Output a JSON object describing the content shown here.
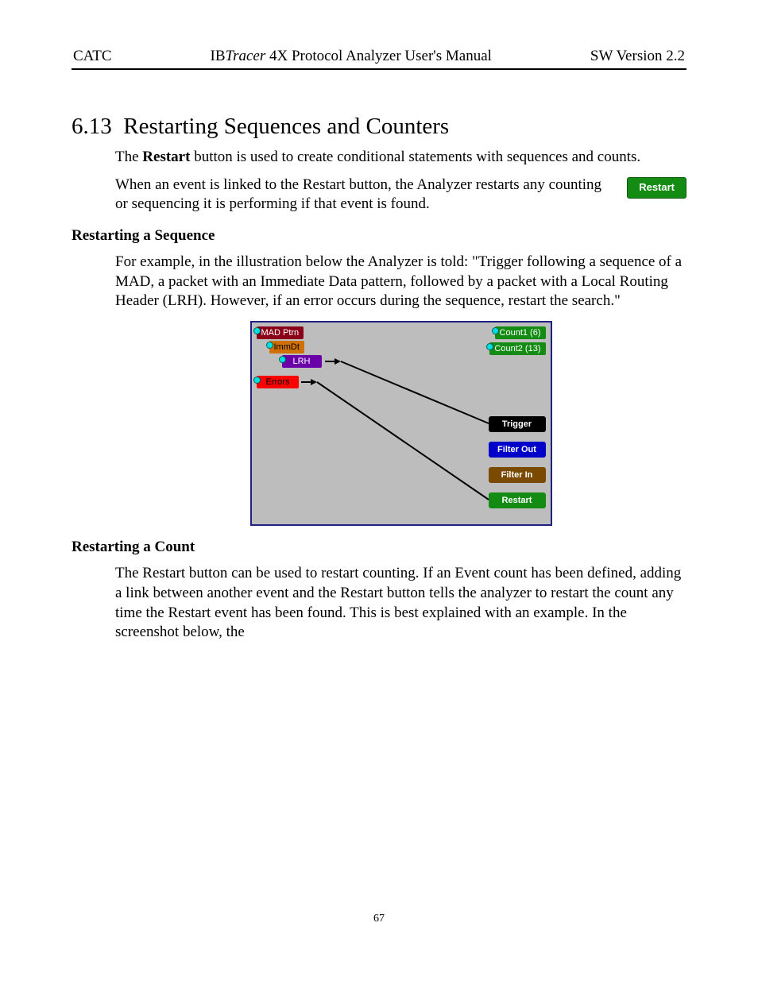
{
  "header": {
    "left": "CATC",
    "center_prefix": "IB",
    "center_italic": "Tracer",
    "center_suffix": " 4X Protocol Analyzer User's Manual",
    "right": "SW Version 2.2"
  },
  "section": {
    "number": "6.13",
    "title": "Restarting Sequences and Counters",
    "para1_a": "The ",
    "para1_bold": "Restart",
    "para1_b": " button is used to create conditional statements with sequences and counts.",
    "para2": "When an event is linked to the Restart button, the Analyzer restarts any counting or sequencing it is performing if that event is found.",
    "restart_btn": "Restart"
  },
  "sub1": {
    "heading": "Restarting a Sequence",
    "para": "For example, in the illustration below the Analyzer is told: \"Trigger following a sequence of a MAD, a packet with an Immediate Data pattern, followed by a packet with a Local Routing Header (LRH). However, if an error occurs during the sequence, restart the search.\""
  },
  "diagram": {
    "events": {
      "mad": "MAD Ptrn",
      "immdt": "ImmDt",
      "lrh": "LRH",
      "errors": "Errors"
    },
    "counts": {
      "c1": "Count1 (6)",
      "c2": "Count2 (13)"
    },
    "actions": {
      "trigger": "Trigger",
      "filter_out": "Filter Out",
      "filter_in": "Filter In",
      "restart": "Restart"
    }
  },
  "sub2": {
    "heading": "Restarting a Count",
    "para": "The Restart button can be used to restart counting. If an Event count has been defined, adding a link between another event and the Restart button tells the analyzer to restart the count any time the Restart event has been found. This is best explained with an example. In the screenshot below, the"
  },
  "page_number": "67"
}
